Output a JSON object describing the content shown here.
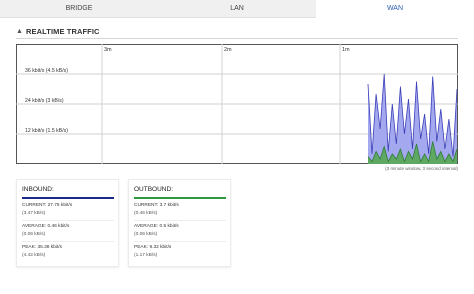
{
  "tabs": [
    {
      "label": "BRIDGE",
      "active": false
    },
    {
      "label": "LAN",
      "active": false
    },
    {
      "label": "WAN",
      "active": true
    }
  ],
  "section": {
    "title": "REALTIME TRAFFIC",
    "caret_icon": "caret-up-icon"
  },
  "graph": {
    "time_labels": [
      "3m",
      "2m",
      "1m"
    ],
    "y_labels": [
      "36 kbit/s (4.5 kB/s)",
      "24 kbit/s (3 kB/s)",
      "12 kbit/s (1.5 kB/s)"
    ],
    "note": "(3 minute window, 3 second interval)",
    "colors": {
      "inbound_fill": "#a4a8ee",
      "inbound_line": "#3b3fb8",
      "outbound_fill": "#5fa864",
      "outbound_line": "#2f7d38"
    }
  },
  "chart_data": {
    "type": "area",
    "title": "",
    "xlabel": "",
    "ylabel": "",
    "ylim": [
      0,
      48
    ],
    "x_unit": "seconds ago",
    "series": [
      {
        "name": "INBOUND",
        "values": [
          32,
          4,
          28,
          14,
          36,
          5,
          24,
          8,
          31,
          12,
          26,
          6,
          33,
          10,
          20,
          4,
          35,
          9,
          22,
          6,
          18,
          3,
          30
        ]
      },
      {
        "name": "OUTBOUND",
        "values": [
          3,
          1,
          5,
          2,
          7,
          1,
          4,
          2,
          6,
          1,
          5,
          2,
          8,
          1,
          4,
          1,
          9,
          2,
          5,
          1,
          4,
          1,
          6
        ]
      }
    ]
  },
  "inbound": {
    "title": "INBOUND:",
    "current": "CURRENT: 27.75 kbit/s",
    "current_sub": "(3.47 kB/s)",
    "average": "AVERAGE: 0.46 kbit/s",
    "average_sub": "(0.06 kB/s)",
    "peak": "PEAK: 35.38 kbit/s",
    "peak_sub": "(4.42 kB/s)"
  },
  "outbound": {
    "title": "OUTBOUND:",
    "current": "CURRENT: 3.7 kbit/s",
    "current_sub": "(0.46 kB/s)",
    "average": "AVERAGE: 0.5 kbit/s",
    "average_sub": "(0.06 kB/s)",
    "peak": "PEAK: 9.32 kbit/s",
    "peak_sub": "(1.17 kB/s)"
  }
}
